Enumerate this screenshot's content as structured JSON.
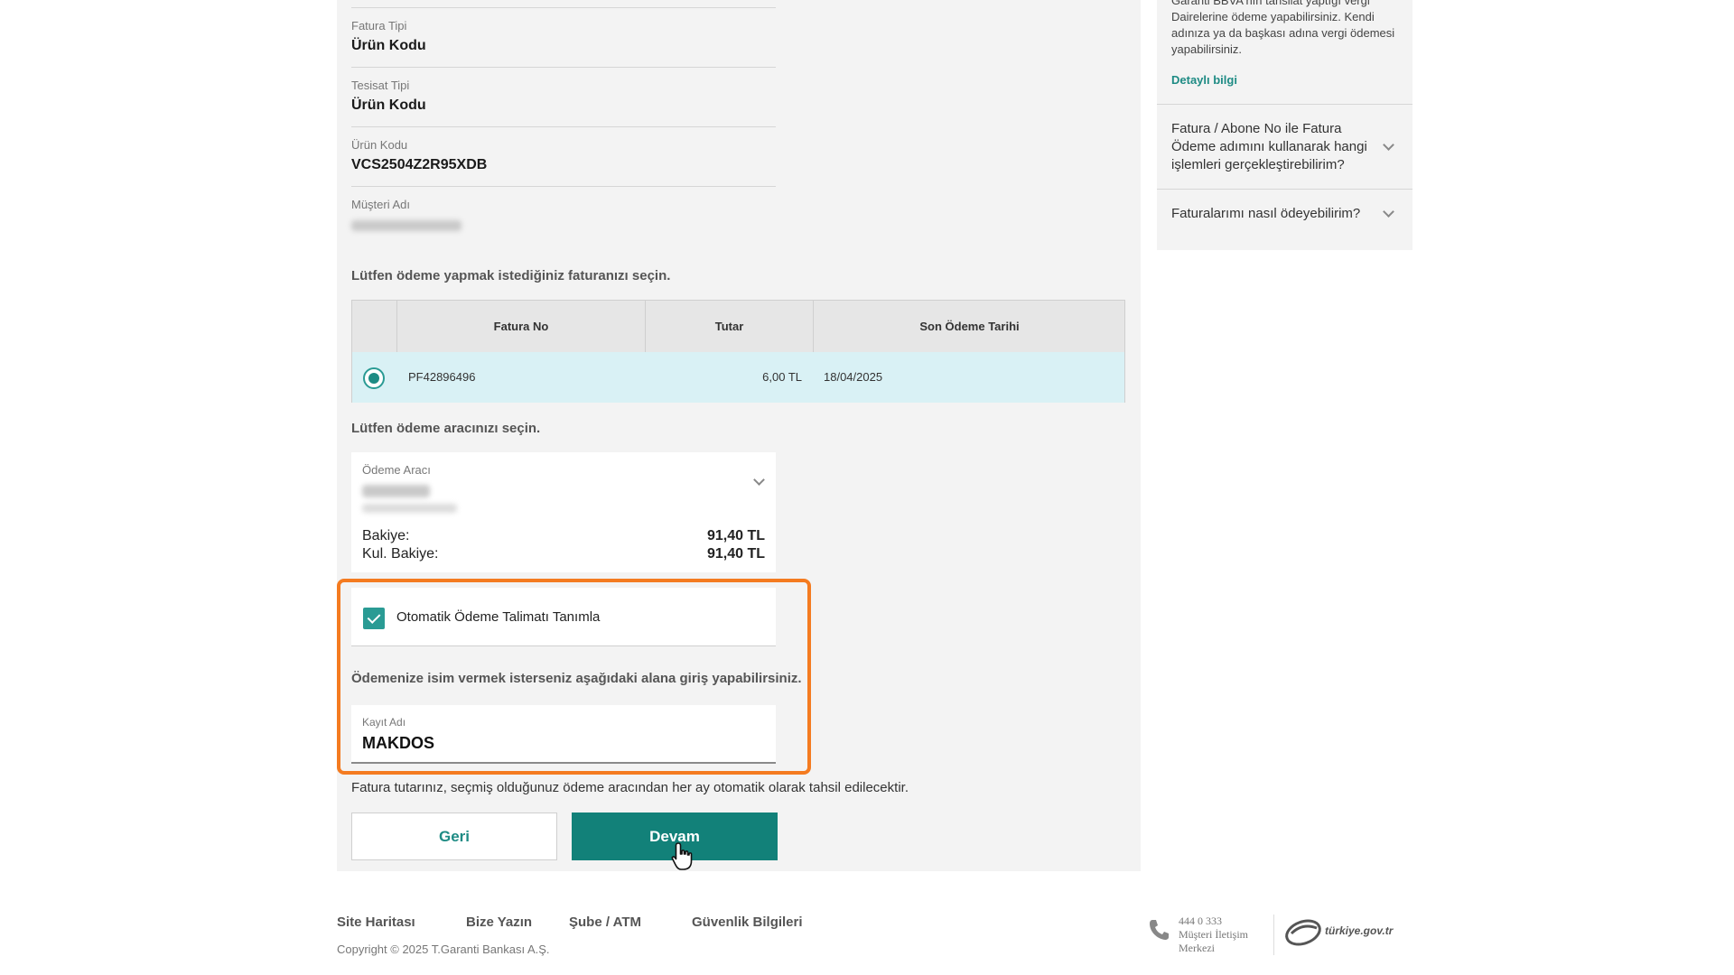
{
  "form": {
    "fields": [
      {
        "label": "Fatura Tipi",
        "value": "Ürün Kodu"
      },
      {
        "label": "Tesisat Tipi",
        "value": "Ürün Kodu"
      },
      {
        "label": "Ürün Kodu",
        "value": "VCS2504Z2R95XDB"
      },
      {
        "label": "Müşteri Adı",
        "value": ""
      }
    ],
    "select_invoice_prompt": "Lütfen ödeme yapmak istediğiniz faturanızı seçin.",
    "invoice_table": {
      "headers": [
        "Fatura No",
        "Tutar",
        "Son Ödeme Tarihi"
      ],
      "rows": [
        {
          "selected": true,
          "invoice_no": "PF42896496",
          "amount": "6,00 TL",
          "due_date": "18/04/2025"
        }
      ]
    },
    "select_payment_prompt": "Lütfen ödeme aracınızı seçin.",
    "payment_tool": {
      "label": "Ödeme Aracı",
      "balance_label": "Bakiye:",
      "balance_value": "91,40 TL",
      "usable_balance_label": "Kul. Bakiye:",
      "usable_balance_value": "91,40 TL"
    },
    "auto_payment": {
      "label": "Otomatik Ödeme Talimatı Tanımla",
      "checked": true
    },
    "name_prompt": "Ödemenize isim vermek isterseniz aşağıdaki alana giriş yapabilirsiniz.",
    "record_name": {
      "label": "Kayıt Adı",
      "value": "MAKDOS"
    },
    "note": "Fatura tutarınız, seçmiş olduğunuz ödeme aracından her ay otomatik olarak tahsil edilecektir.",
    "back_label": "Geri",
    "next_label": "Devam"
  },
  "sidebar": {
    "info_lines": [
      "Garanti BBVA'nın tahsilat yaptığı vergi",
      "Dairelerine ödeme yapabilirsiniz. Kendi",
      "adınıza ya da başkası adına vergi ödemesi",
      "yapabilirsiniz."
    ],
    "detail_link": "Detaylı bilgi",
    "faqs": [
      {
        "question": "Fatura / Abone No ile Fatura Ödeme adımını kullanarak hangi işlemleri gerçekleştirebilirim?"
      },
      {
        "question": "Faturalarımı nasıl ödeyebilirim?"
      }
    ]
  },
  "footer": {
    "links": [
      "Site Haritası",
      "Bize Yazın",
      "Şube / ATM",
      "Güvenlik Bilgileri"
    ],
    "copyright": "Copyright © 2025 T.Garanti Bankası A.Ş.",
    "phone_number": "444 0 333",
    "phone_caption": "Müşteri İletişim Merkezi",
    "gov_logo_text": "türkiye.gov.tr"
  },
  "colors": {
    "accent": "#128179",
    "highlight": "#f47b20",
    "selected_row": "#d9f1f5"
  }
}
